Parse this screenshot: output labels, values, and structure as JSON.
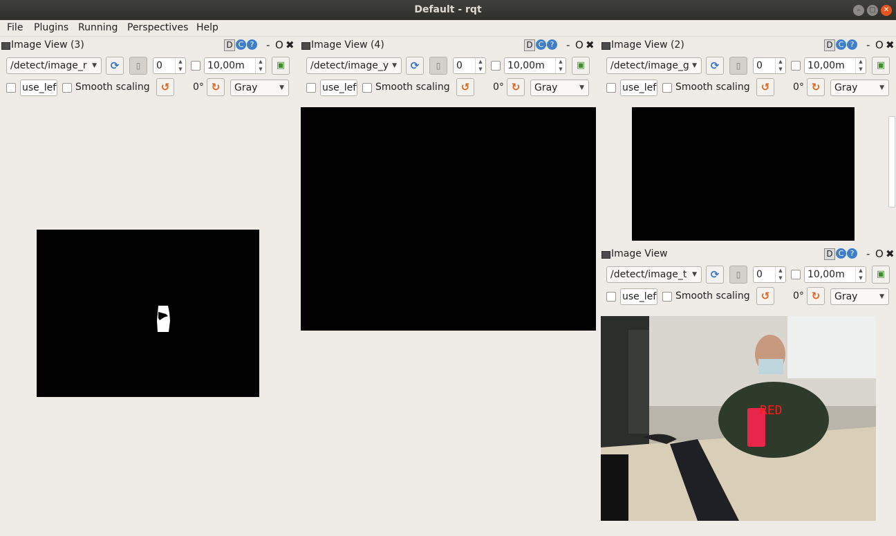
{
  "window": {
    "title": "Default - rqt",
    "buttons": [
      "–",
      "▢",
      "✕"
    ]
  },
  "menu": [
    "File",
    "Plugins",
    "Running",
    "Perspectives",
    "Help"
  ],
  "panels": {
    "p3": {
      "title": "Image View (3)",
      "topic": "/detect/image_r",
      "spin_value": "0",
      "rate": "10,00m",
      "mouse_left": "use_left",
      "smooth": "Smooth scaling",
      "rotation": "0°",
      "color": "Gray"
    },
    "p4": {
      "title": "Image View (4)",
      "topic": "/detect/image_y",
      "spin_value": "0",
      "rate": "10,00m",
      "mouse_left": "use_left",
      "smooth": "Smooth scaling",
      "rotation": "0°",
      "color": "Gray"
    },
    "p2": {
      "title": "Image View (2)",
      "topic": "/detect/image_g",
      "spin_value": "0",
      "rate": "10,00m",
      "mouse_left": "use_left",
      "smooth": "Smooth scaling",
      "rotation": "0°",
      "color": "Gray"
    },
    "p1": {
      "title": "Image View",
      "topic": "/detect/image_t",
      "spin_value": "0",
      "rate": "10,00m",
      "mouse_left": "use_left",
      "smooth": "Smooth scaling",
      "rotation": "0°",
      "color": "Gray",
      "detection_label": "RED"
    }
  },
  "title_controls": {
    "d": "D",
    "reload": "C",
    "help": "?",
    "minimize": "-",
    "float": "O",
    "close": "✖"
  },
  "colors": {
    "accent_blue": "#3d7fcf",
    "close_orange": "#e9541f",
    "detection_red": "#e8264b"
  }
}
